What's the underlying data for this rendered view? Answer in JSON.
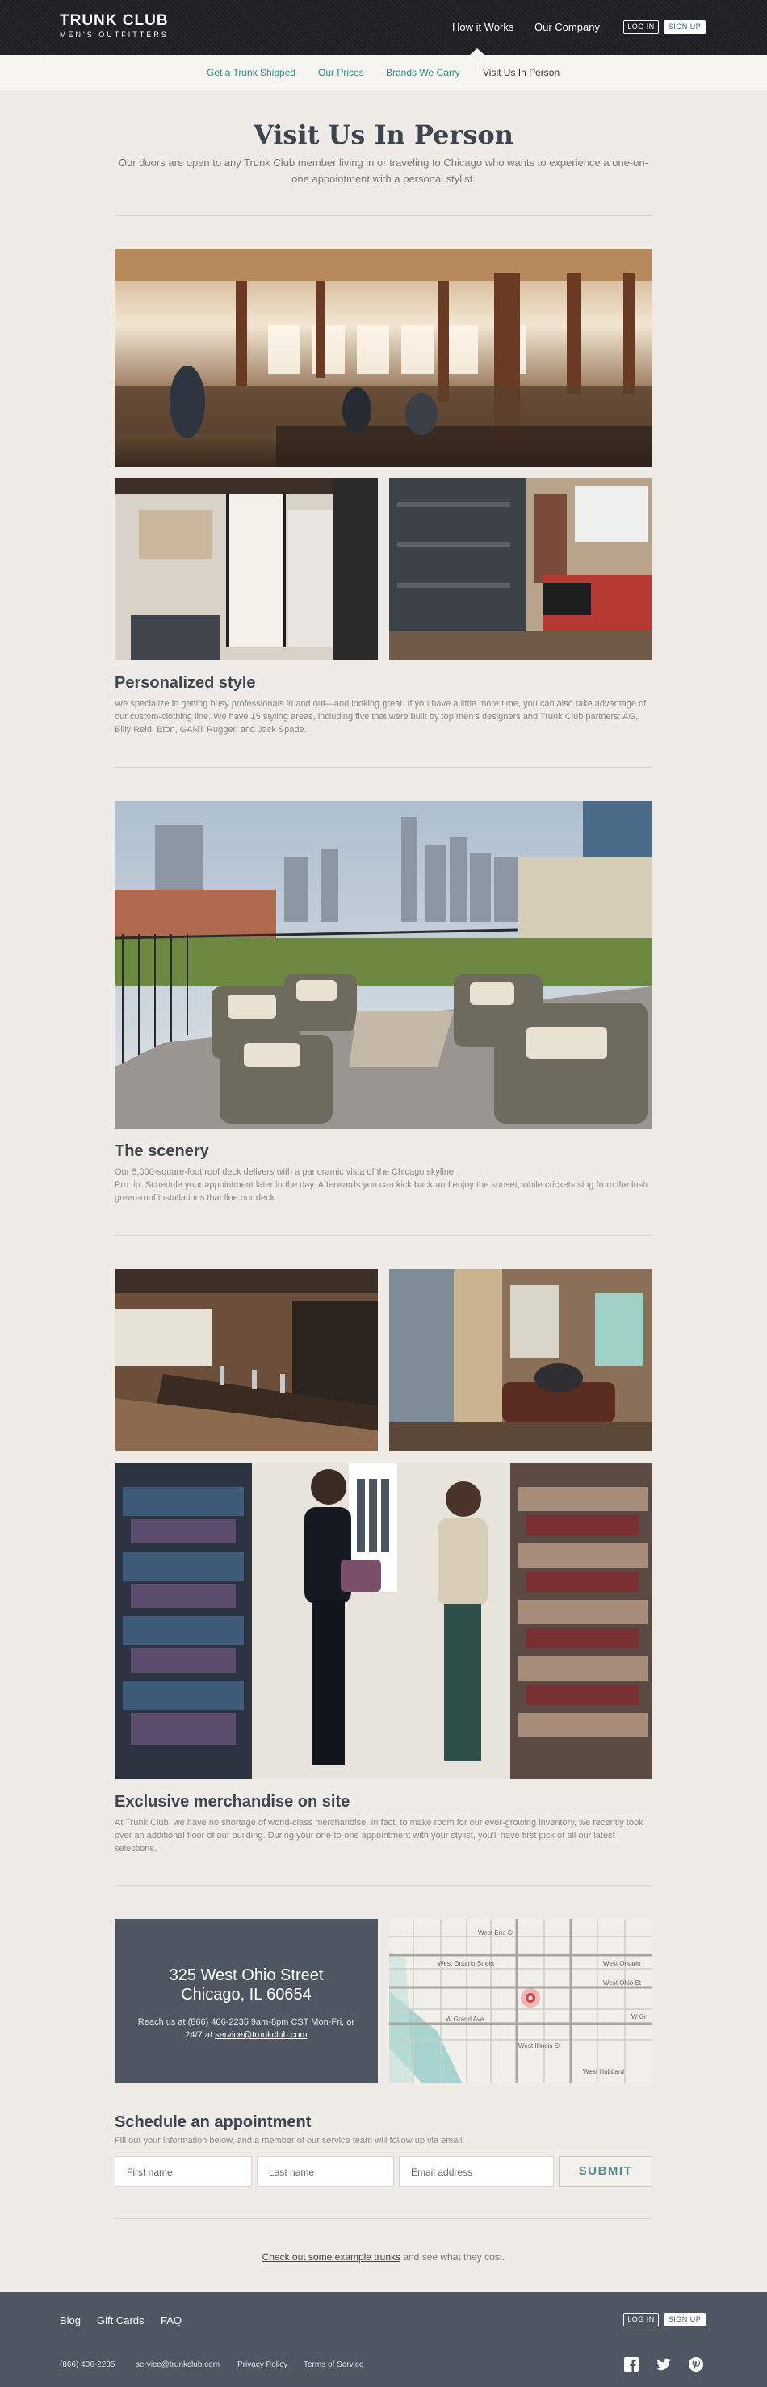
{
  "header": {
    "logo_main": "TRUNK CLUB",
    "logo_sub": "MEN'S OUTFITTERS",
    "nav": [
      "How it Works",
      "Our Company"
    ],
    "login": "LOG IN",
    "signup": "SIGN UP"
  },
  "subnav": [
    "Get a Trunk Shipped",
    "Our Prices",
    "Brands We Carry",
    "Visit Us In Person"
  ],
  "page": {
    "title": "Visit Us In Person",
    "intro": "Our doors are open to any Trunk Club member living in or traveling to Chicago who wants to experience a one-on-one appointment with a personal stylist."
  },
  "sections": [
    {
      "heading": "Personalized style",
      "text": "We specialize in getting busy professionals in and out—and looking great. If you have a little more time, you can also take advantage of our custom-clothing line. We have 15 styling areas, including five that were built by top men's designers and Trunk Club partners: AG, Billy Reid, Eton, GANT Rugger, and Jack Spade."
    },
    {
      "heading": "The scenery",
      "text": "Our 5,000-square-foot roof deck delivers with a panoramic vista of the Chicago skyline.",
      "text2": "Pro tip: Schedule your appointment later in the day. Afterwards you can kick back and enjoy the sunset, while crickets sing from the lush green-roof installations that line our deck."
    },
    {
      "heading": "Exclusive merchandise on site",
      "text": "At Trunk Club, we have no shortage of world-class merchandise. In fact, to make room for our ever-growing inventory, we recently took over an additional floor of our building. During your one-to-one appointment with your stylist, you'll have first pick of all our latest selections."
    }
  ],
  "address": {
    "street": "325 West Ohio Street",
    "city": "Chicago, IL 60654",
    "reach": "Reach us at (866) 406-2235 9am-8pm CST Mon-Fri, or 24/7 at",
    "email": "service@trunkclub.com"
  },
  "map": {
    "streets": [
      "West Erie St",
      "West Ontario Street",
      "West Ontario",
      "West Ohio St",
      "W Grand Ave",
      "W Gr",
      "West Illinois St",
      "West Hubbard"
    ]
  },
  "schedule": {
    "heading": "Schedule an appointment",
    "note": "Fill out your information below, and a member of our service team will follow up via email.",
    "first_name": "First name",
    "last_name": "Last name",
    "email": "Email address",
    "submit": "SUBMIT"
  },
  "example": {
    "link": "Check out some example trunks",
    "rest": " and see what they cost."
  },
  "footer": {
    "links": [
      "Blog",
      "Gift Cards",
      "FAQ"
    ],
    "login": "LOG IN",
    "signup": "SIGN UP",
    "phone": "(866) 406-2235",
    "email": "service@trunkclub.com",
    "privacy": "Privacy Policy",
    "terms": "Terms of Service",
    "social_icons": [
      "facebook-icon",
      "twitter-icon",
      "pinterest-icon"
    ]
  },
  "colors": {
    "accent_teal": "#2f8a83",
    "header_dark": "#232428",
    "slate": "#4d5661",
    "page_bg": "#efebe6"
  }
}
